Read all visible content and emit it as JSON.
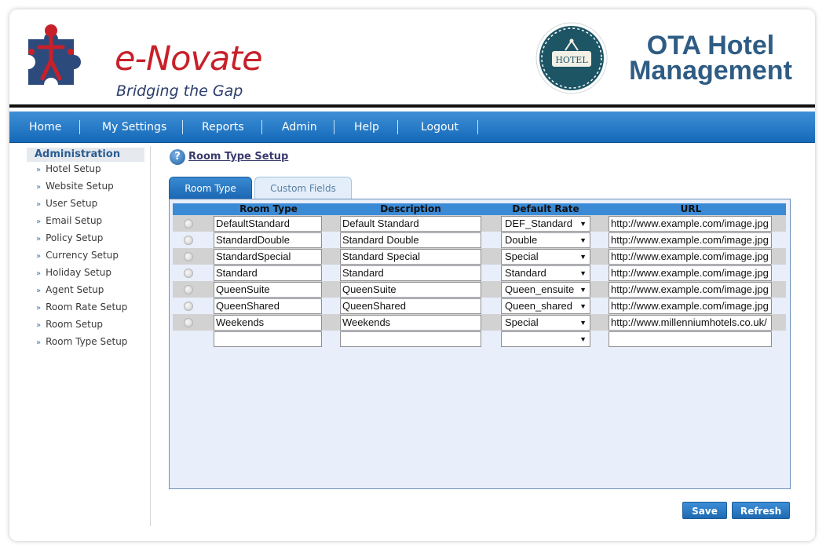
{
  "brand": {
    "name": "e-Novate",
    "tagline": "Bridging the Gap",
    "badge_text": "HOTEL",
    "product_title_line1": "OTA Hotel",
    "product_title_line2": "Management"
  },
  "nav": {
    "items": [
      "Home",
      "My Settings",
      "Reports",
      "Admin",
      "Help",
      "Logout"
    ]
  },
  "sidebar": {
    "heading": "Administration",
    "items": [
      "Hotel Setup",
      "Website Setup",
      "User Setup",
      "Email Setup",
      "Policy Setup",
      "Currency Setup",
      "Holiday Setup",
      "Agent Setup",
      "Room Rate Setup",
      "Room Setup",
      "Room Type Setup"
    ]
  },
  "page": {
    "title": "Room Type Setup",
    "help_glyph": "?"
  },
  "tabs": {
    "room_type": "Room Type",
    "custom_fields": "Custom Fields"
  },
  "grid": {
    "columns": [
      "Room Type",
      "Description",
      "Default Rate",
      "URL"
    ],
    "rows": [
      {
        "room_type": "DefaultStandard",
        "description": "Default Standard",
        "rate": "DEF_Standard",
        "url": "http://www.example.com/image.jpg"
      },
      {
        "room_type": "StandardDouble",
        "description": "Standard Double",
        "rate": "Double",
        "url": "http://www.example.com/image.jpg"
      },
      {
        "room_type": "StandardSpecial",
        "description": "Standard Special",
        "rate": "Special",
        "url": "http://www.example.com/image.jpg"
      },
      {
        "room_type": "Standard",
        "description": "Standard",
        "rate": "Standard",
        "url": "http://www.example.com/image.jpg"
      },
      {
        "room_type": "QueenSuite",
        "description": "QueenSuite",
        "rate": "Queen_ensuite",
        "url": "http://www.example.com/image.jpg"
      },
      {
        "room_type": "QueenShared",
        "description": "QueenShared",
        "rate": "Queen_shared",
        "url": "http://www.example.com/image.jpg"
      },
      {
        "room_type": "Weekends",
        "description": "Weekends",
        "rate": "Special",
        "url": "http://www.millenniumhotels.co.uk/"
      },
      {
        "room_type": "",
        "description": "",
        "rate": "",
        "url": ""
      }
    ]
  },
  "buttons": {
    "save": "Save",
    "refresh": "Refresh"
  },
  "colors": {
    "nav_blue": "#1a6bb8",
    "brand_red": "#c8202a",
    "title_blue": "#2f5c84",
    "panel_bg": "#e8eefa"
  }
}
